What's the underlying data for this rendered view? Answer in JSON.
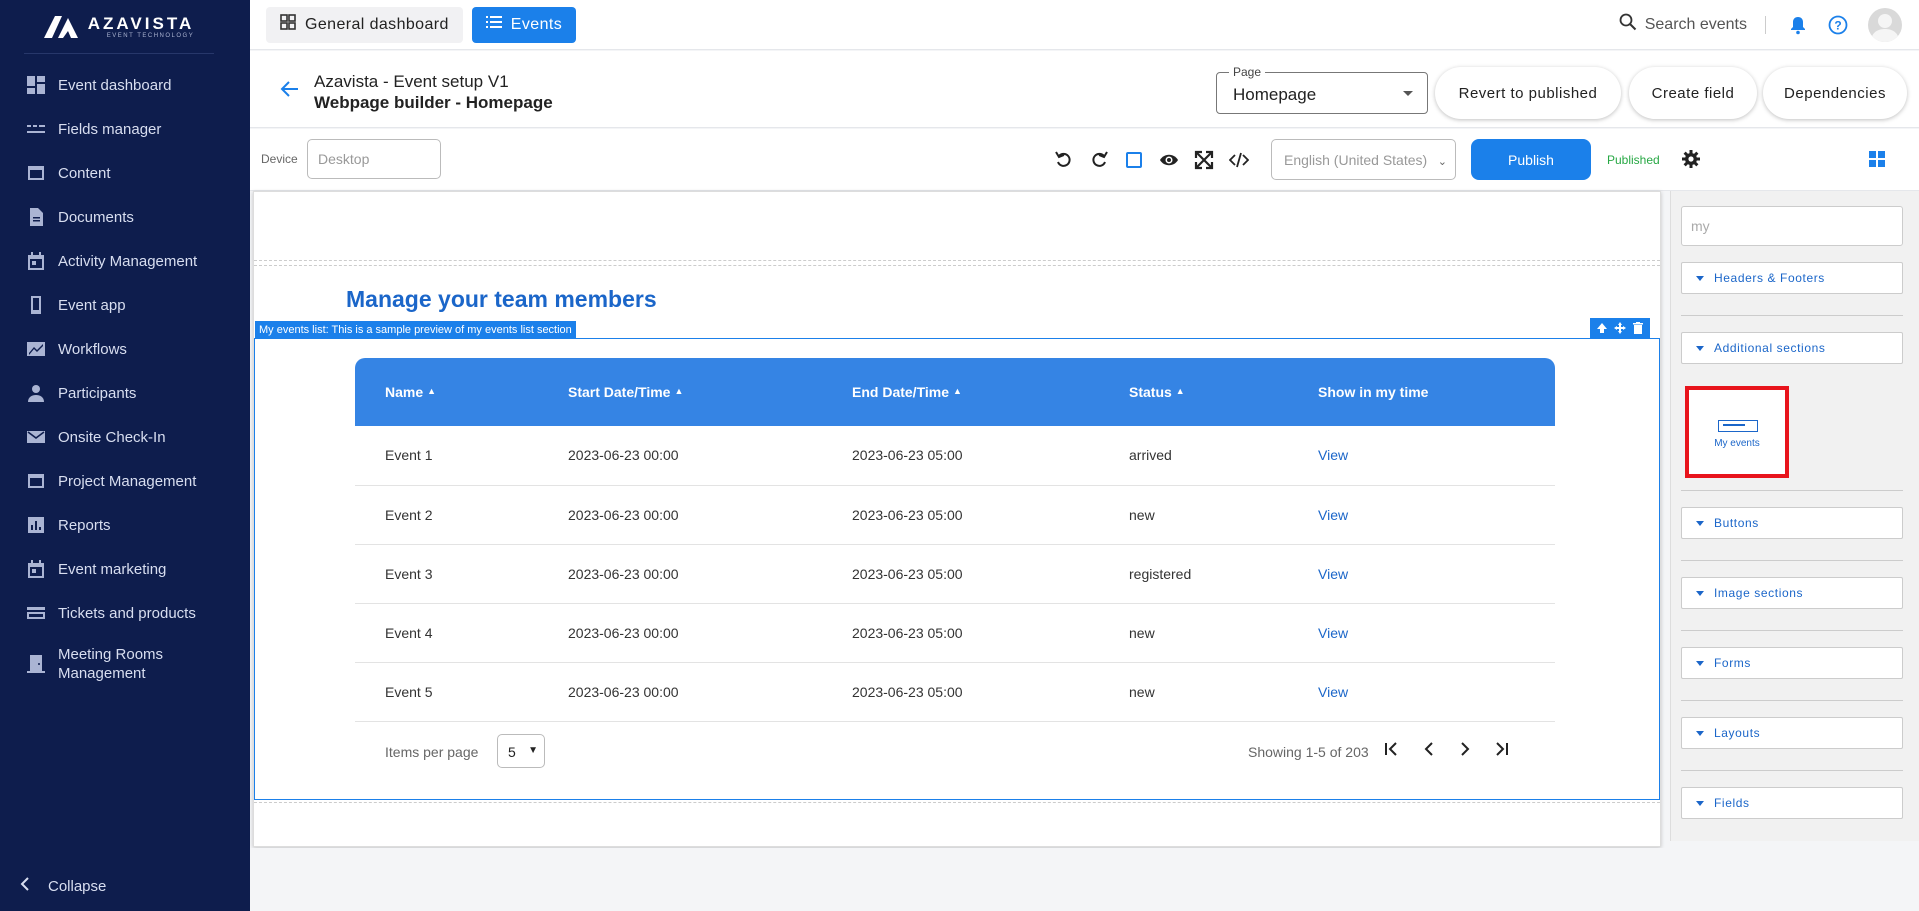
{
  "brand": {
    "name": "AZAVISTA",
    "tagline": "EVENT TECHNOLOGY"
  },
  "sidebar": {
    "items": [
      {
        "label": "Event dashboard",
        "icon": "dashboard-icon"
      },
      {
        "label": "Fields manager",
        "icon": "fields-icon"
      },
      {
        "label": "Content",
        "icon": "content-icon"
      },
      {
        "label": "Documents",
        "icon": "document-icon"
      },
      {
        "label": "Activity Management",
        "icon": "calendar-icon"
      },
      {
        "label": "Event app",
        "icon": "phone-icon"
      },
      {
        "label": "Workflows",
        "icon": "workflow-icon"
      },
      {
        "label": "Participants",
        "icon": "person-icon"
      },
      {
        "label": "Onsite Check-In",
        "icon": "mail-icon"
      },
      {
        "label": "Project Management",
        "icon": "project-icon"
      },
      {
        "label": "Reports",
        "icon": "reports-icon"
      },
      {
        "label": "Event marketing",
        "icon": "calendar-icon"
      },
      {
        "label": "Tickets and products",
        "icon": "card-icon"
      },
      {
        "label": "Meeting Rooms Management",
        "icon": "door-icon"
      }
    ],
    "collapse_label": "Collapse"
  },
  "topbar": {
    "tabs": [
      {
        "label": "General dashboard",
        "icon": "grid-icon"
      },
      {
        "label": "Events",
        "icon": "list-icon"
      }
    ],
    "search_label": "Search events"
  },
  "header": {
    "title": "Azavista - Event setup V1",
    "subtitle": "Webpage builder - Homepage",
    "page_select": {
      "legend": "Page",
      "value": "Homepage"
    },
    "buttons": {
      "revert": "Revert to published",
      "create": "Create field",
      "dependencies": "Dependencies"
    }
  },
  "toolbar": {
    "device_label": "Device",
    "device_placeholder": "Desktop",
    "language_placeholder": "English (United States)",
    "publish_label": "Publish",
    "status_label": "Published"
  },
  "canvas": {
    "heading": "Manage your team members",
    "section_tag": "My events list: This is a sample preview of my events list section",
    "table": {
      "columns": [
        "Name",
        "Start Date/Time",
        "End Date/Time",
        "Status",
        "Show in my time"
      ],
      "rows": [
        {
          "name": "Event 1",
          "start": "2023-06-23 00:00",
          "end": "2023-06-23 05:00",
          "status": "arrived",
          "link": "View"
        },
        {
          "name": "Event 2",
          "start": "2023-06-23 00:00",
          "end": "2023-06-23 05:00",
          "status": "new",
          "link": "View"
        },
        {
          "name": "Event 3",
          "start": "2023-06-23 00:00",
          "end": "2023-06-23 05:00",
          "status": "registered",
          "link": "View"
        },
        {
          "name": "Event 4",
          "start": "2023-06-23 00:00",
          "end": "2023-06-23 05:00",
          "status": "new",
          "link": "View"
        },
        {
          "name": "Event 5",
          "start": "2023-06-23 00:00",
          "end": "2023-06-23 05:00",
          "status": "new",
          "link": "View"
        }
      ]
    },
    "pager": {
      "items_per_page_label": "Items per page",
      "items_per_page_value": "5",
      "showing": "Showing 1-5 of 203"
    }
  },
  "right_panel": {
    "search_value": "my",
    "categories": [
      "Headers & Footers",
      "Additional sections",
      "Buttons",
      "Image sections",
      "Forms",
      "Layouts",
      "Fields"
    ],
    "highlighted_block": "My events"
  },
  "colors": {
    "sidebar": "#0e1d4d",
    "accent": "#1b80ea",
    "published": "#27a844",
    "highlight": "#e8141c"
  }
}
